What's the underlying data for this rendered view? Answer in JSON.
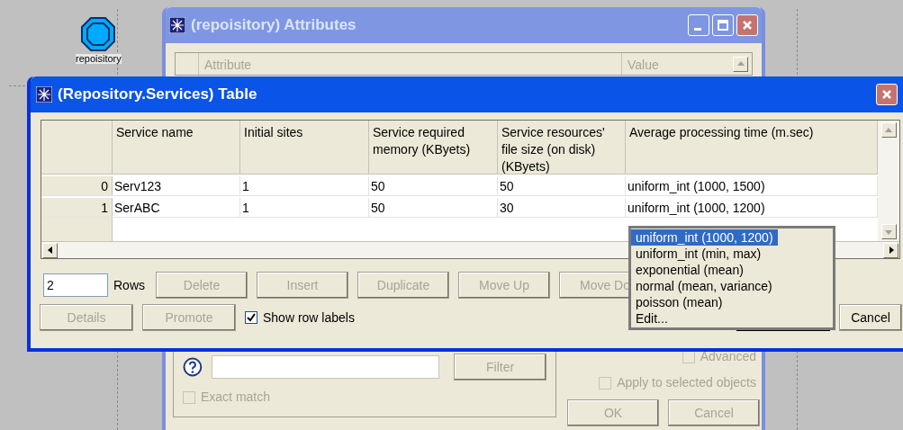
{
  "canvas": {
    "node": {
      "label": "repoisitory"
    }
  },
  "attributes_window": {
    "title": "(repoisitory) Attributes",
    "columns": [
      "Attribute",
      "Value"
    ],
    "advanced": {
      "label": "Advanced",
      "checked": false
    },
    "filter_button": {
      "label": "Filter",
      "disabled": true
    },
    "exact_match": {
      "label": "Exact match",
      "checked": false
    },
    "apply_to_selected": {
      "label": "Apply to selected objects",
      "checked": false
    },
    "buttons": [
      {
        "label": "OK",
        "disabled": true
      },
      {
        "label": "Cancel",
        "disabled": true
      }
    ]
  },
  "table_window": {
    "title": "(Repository.Services) Table",
    "columns": [
      "Service name",
      "Initial sites",
      "Service required memory (KByets)",
      "Service resources' file size (on disk) (KByets)",
      "Average processing time  (m.sec)"
    ],
    "rows": [
      {
        "label": "0",
        "cells": [
          "Serv123",
          "1",
          "50",
          "50",
          "uniform_int (1000, 1500)"
        ]
      },
      {
        "label": "1",
        "cells": [
          "SerABC",
          "1",
          "50",
          "30",
          "uniform_int (1000, 1200)"
        ]
      }
    ],
    "rows_count": "2",
    "rows_label": "Rows",
    "buttons": [
      {
        "label": "Delete",
        "disabled": true
      },
      {
        "label": "Insert",
        "disabled": true
      },
      {
        "label": "Duplicate",
        "disabled": true
      },
      {
        "label": "Move Up",
        "disabled": true
      },
      {
        "label": "Move Do",
        "disabled": true
      }
    ],
    "buttons_2": [
      {
        "label": "Details",
        "disabled": true
      },
      {
        "label": "Promote",
        "disabled": true
      }
    ],
    "show_row_labels": {
      "label": "Show row labels",
      "checked": true
    },
    "cancel_button": {
      "label": "Cancel",
      "disabled": false
    }
  },
  "dropdown": {
    "items": [
      {
        "label": "uniform_int (1000, 1200)",
        "selected": true
      },
      {
        "label": "uniform_int (min, max)",
        "selected": false
      },
      {
        "label": "exponential (mean)",
        "selected": false
      },
      {
        "label": "normal (mean, variance)",
        "selected": false
      },
      {
        "label": "poisson (mean)",
        "selected": false
      },
      {
        "label": "Edit...",
        "selected": false
      }
    ]
  }
}
